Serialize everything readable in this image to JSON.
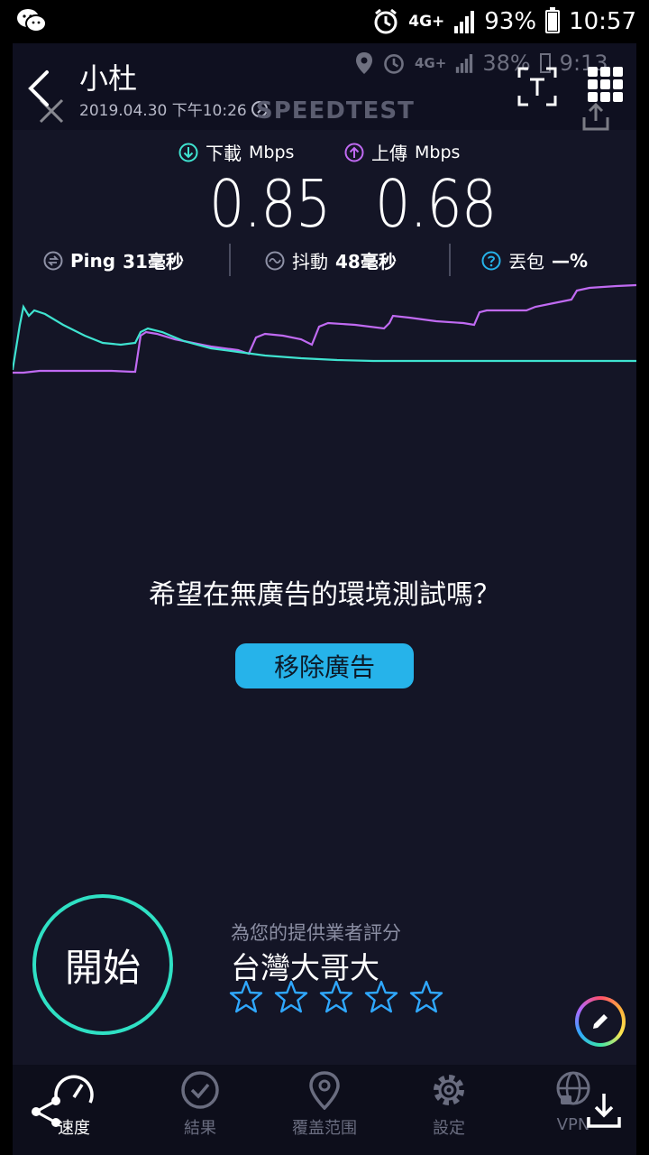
{
  "status_bar": {
    "signal": "4G+",
    "battery": "93%",
    "time": "10:57"
  },
  "header": {
    "title": "小杜",
    "subtitle": "2019.04.30 下午10:26",
    "ghost_brand": "SPEEDTEST",
    "ghost_battery": "38%",
    "ghost_time": "9:13"
  },
  "stats": {
    "download_label": "下載",
    "download_unit": "Mbps",
    "download_value": "0.85",
    "upload_label": "上傳",
    "upload_unit": "Mbps",
    "upload_value": "0.68"
  },
  "metrics": {
    "ping_label": "Ping",
    "ping_value": "31毫秒",
    "jitter_label": "抖動",
    "jitter_value": "48毫秒",
    "loss_label": "丟包",
    "loss_value": "—%"
  },
  "colors": {
    "download": "#3fe3d0",
    "upload": "#c06af2",
    "accent": "#26b3ea",
    "start_ring": "#2fe0c4"
  },
  "promo": {
    "text": "希望在無廣告的環境測試嗎？",
    "button": "移除廣告"
  },
  "start": {
    "label": "開始"
  },
  "rating": {
    "label": "為您的提供業者評分",
    "provider": "台灣大哥大",
    "stars_total": 5,
    "stars_filled": 0
  },
  "nav": {
    "items": [
      {
        "label": "速度",
        "icon": "speedometer-icon"
      },
      {
        "label": "結果",
        "icon": "check-circle-icon"
      },
      {
        "label": "覆盖范围",
        "icon": "map-pin-icon"
      },
      {
        "label": "設定",
        "icon": "gear-icon"
      },
      {
        "label": "VPN",
        "icon": "globe-lock-icon"
      }
    ]
  }
}
